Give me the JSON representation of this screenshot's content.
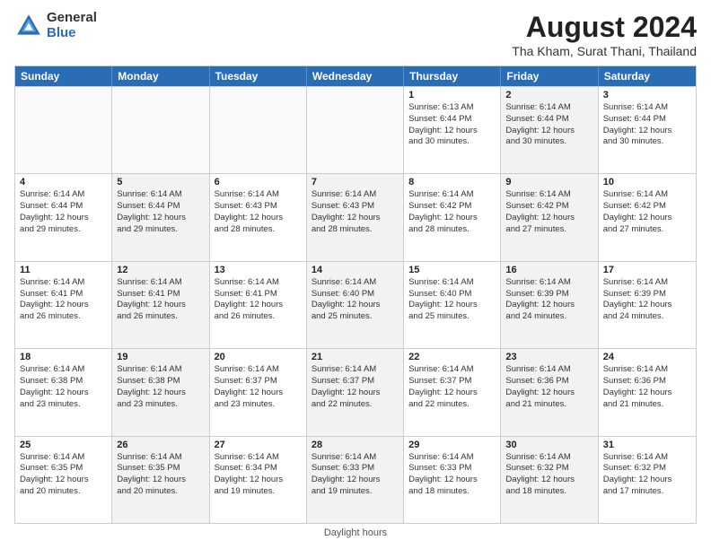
{
  "header": {
    "logo_general": "General",
    "logo_blue": "Blue",
    "month_year": "August 2024",
    "location": "Tha Kham, Surat Thani, Thailand"
  },
  "days_of_week": [
    "Sunday",
    "Monday",
    "Tuesday",
    "Wednesday",
    "Thursday",
    "Friday",
    "Saturday"
  ],
  "footer": {
    "note": "Daylight hours"
  },
  "weeks": [
    [
      {
        "day": "",
        "info": "",
        "shaded": false,
        "empty": true
      },
      {
        "day": "",
        "info": "",
        "shaded": false,
        "empty": true
      },
      {
        "day": "",
        "info": "",
        "shaded": false,
        "empty": true
      },
      {
        "day": "",
        "info": "",
        "shaded": false,
        "empty": true
      },
      {
        "day": "1",
        "info": "Sunrise: 6:13 AM\nSunset: 6:44 PM\nDaylight: 12 hours\nand 30 minutes.",
        "shaded": false,
        "empty": false
      },
      {
        "day": "2",
        "info": "Sunrise: 6:14 AM\nSunset: 6:44 PM\nDaylight: 12 hours\nand 30 minutes.",
        "shaded": true,
        "empty": false
      },
      {
        "day": "3",
        "info": "Sunrise: 6:14 AM\nSunset: 6:44 PM\nDaylight: 12 hours\nand 30 minutes.",
        "shaded": false,
        "empty": false
      }
    ],
    [
      {
        "day": "4",
        "info": "Sunrise: 6:14 AM\nSunset: 6:44 PM\nDaylight: 12 hours\nand 29 minutes.",
        "shaded": false,
        "empty": false
      },
      {
        "day": "5",
        "info": "Sunrise: 6:14 AM\nSunset: 6:44 PM\nDaylight: 12 hours\nand 29 minutes.",
        "shaded": true,
        "empty": false
      },
      {
        "day": "6",
        "info": "Sunrise: 6:14 AM\nSunset: 6:43 PM\nDaylight: 12 hours\nand 28 minutes.",
        "shaded": false,
        "empty": false
      },
      {
        "day": "7",
        "info": "Sunrise: 6:14 AM\nSunset: 6:43 PM\nDaylight: 12 hours\nand 28 minutes.",
        "shaded": true,
        "empty": false
      },
      {
        "day": "8",
        "info": "Sunrise: 6:14 AM\nSunset: 6:42 PM\nDaylight: 12 hours\nand 28 minutes.",
        "shaded": false,
        "empty": false
      },
      {
        "day": "9",
        "info": "Sunrise: 6:14 AM\nSunset: 6:42 PM\nDaylight: 12 hours\nand 27 minutes.",
        "shaded": true,
        "empty": false
      },
      {
        "day": "10",
        "info": "Sunrise: 6:14 AM\nSunset: 6:42 PM\nDaylight: 12 hours\nand 27 minutes.",
        "shaded": false,
        "empty": false
      }
    ],
    [
      {
        "day": "11",
        "info": "Sunrise: 6:14 AM\nSunset: 6:41 PM\nDaylight: 12 hours\nand 26 minutes.",
        "shaded": false,
        "empty": false
      },
      {
        "day": "12",
        "info": "Sunrise: 6:14 AM\nSunset: 6:41 PM\nDaylight: 12 hours\nand 26 minutes.",
        "shaded": true,
        "empty": false
      },
      {
        "day": "13",
        "info": "Sunrise: 6:14 AM\nSunset: 6:41 PM\nDaylight: 12 hours\nand 26 minutes.",
        "shaded": false,
        "empty": false
      },
      {
        "day": "14",
        "info": "Sunrise: 6:14 AM\nSunset: 6:40 PM\nDaylight: 12 hours\nand 25 minutes.",
        "shaded": true,
        "empty": false
      },
      {
        "day": "15",
        "info": "Sunrise: 6:14 AM\nSunset: 6:40 PM\nDaylight: 12 hours\nand 25 minutes.",
        "shaded": false,
        "empty": false
      },
      {
        "day": "16",
        "info": "Sunrise: 6:14 AM\nSunset: 6:39 PM\nDaylight: 12 hours\nand 24 minutes.",
        "shaded": true,
        "empty": false
      },
      {
        "day": "17",
        "info": "Sunrise: 6:14 AM\nSunset: 6:39 PM\nDaylight: 12 hours\nand 24 minutes.",
        "shaded": false,
        "empty": false
      }
    ],
    [
      {
        "day": "18",
        "info": "Sunrise: 6:14 AM\nSunset: 6:38 PM\nDaylight: 12 hours\nand 23 minutes.",
        "shaded": false,
        "empty": false
      },
      {
        "day": "19",
        "info": "Sunrise: 6:14 AM\nSunset: 6:38 PM\nDaylight: 12 hours\nand 23 minutes.",
        "shaded": true,
        "empty": false
      },
      {
        "day": "20",
        "info": "Sunrise: 6:14 AM\nSunset: 6:37 PM\nDaylight: 12 hours\nand 23 minutes.",
        "shaded": false,
        "empty": false
      },
      {
        "day": "21",
        "info": "Sunrise: 6:14 AM\nSunset: 6:37 PM\nDaylight: 12 hours\nand 22 minutes.",
        "shaded": true,
        "empty": false
      },
      {
        "day": "22",
        "info": "Sunrise: 6:14 AM\nSunset: 6:37 PM\nDaylight: 12 hours\nand 22 minutes.",
        "shaded": false,
        "empty": false
      },
      {
        "day": "23",
        "info": "Sunrise: 6:14 AM\nSunset: 6:36 PM\nDaylight: 12 hours\nand 21 minutes.",
        "shaded": true,
        "empty": false
      },
      {
        "day": "24",
        "info": "Sunrise: 6:14 AM\nSunset: 6:36 PM\nDaylight: 12 hours\nand 21 minutes.",
        "shaded": false,
        "empty": false
      }
    ],
    [
      {
        "day": "25",
        "info": "Sunrise: 6:14 AM\nSunset: 6:35 PM\nDaylight: 12 hours\nand 20 minutes.",
        "shaded": false,
        "empty": false
      },
      {
        "day": "26",
        "info": "Sunrise: 6:14 AM\nSunset: 6:35 PM\nDaylight: 12 hours\nand 20 minutes.",
        "shaded": true,
        "empty": false
      },
      {
        "day": "27",
        "info": "Sunrise: 6:14 AM\nSunset: 6:34 PM\nDaylight: 12 hours\nand 19 minutes.",
        "shaded": false,
        "empty": false
      },
      {
        "day": "28",
        "info": "Sunrise: 6:14 AM\nSunset: 6:33 PM\nDaylight: 12 hours\nand 19 minutes.",
        "shaded": true,
        "empty": false
      },
      {
        "day": "29",
        "info": "Sunrise: 6:14 AM\nSunset: 6:33 PM\nDaylight: 12 hours\nand 18 minutes.",
        "shaded": false,
        "empty": false
      },
      {
        "day": "30",
        "info": "Sunrise: 6:14 AM\nSunset: 6:32 PM\nDaylight: 12 hours\nand 18 minutes.",
        "shaded": true,
        "empty": false
      },
      {
        "day": "31",
        "info": "Sunrise: 6:14 AM\nSunset: 6:32 PM\nDaylight: 12 hours\nand 17 minutes.",
        "shaded": false,
        "empty": false
      }
    ]
  ]
}
